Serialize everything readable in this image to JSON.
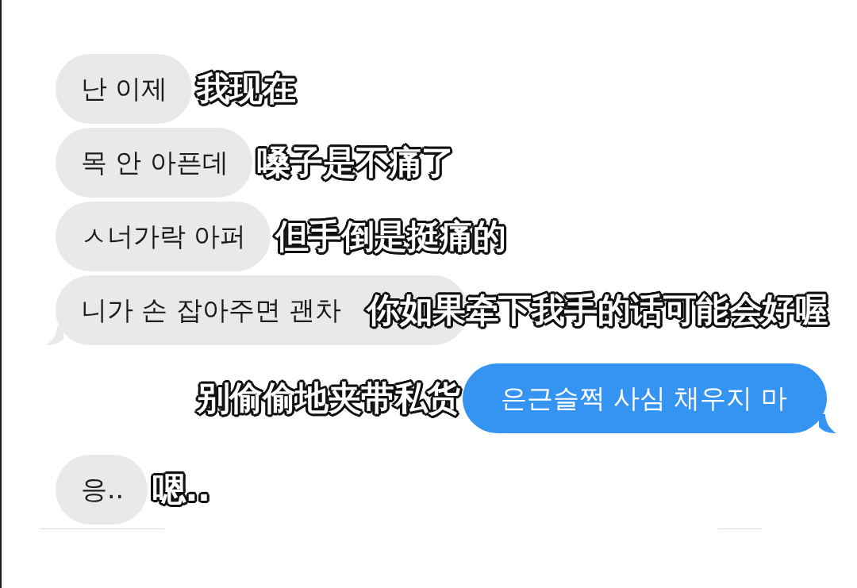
{
  "conversation": {
    "messages": [
      {
        "kind": "received",
        "text": "난 이제",
        "tail": false,
        "caption": "我现在",
        "caption_overlaps": false
      },
      {
        "kind": "received",
        "text": "목 안 아픈데",
        "tail": false,
        "caption": "嗓子是不痛了",
        "caption_overlaps": false
      },
      {
        "kind": "received",
        "text": "ㅅ너가락 아퍼",
        "tail": false,
        "caption": "但手倒是挺痛的",
        "caption_overlaps": false
      },
      {
        "kind": "received",
        "text": "니가 손 잡아주면 괜차",
        "tail": true,
        "caption": "你如果牵下我手的话可能会好喔",
        "caption_overlaps": true
      },
      {
        "kind": "sent",
        "text": "은근슬쩍 사심 채우지 마",
        "tail": true,
        "caption": "别偷偷地夹带私货",
        "caption_overlaps": false
      },
      {
        "kind": "received",
        "text": "응..",
        "tail": false,
        "caption": "嗯..",
        "caption_overlaps": false
      }
    ]
  }
}
